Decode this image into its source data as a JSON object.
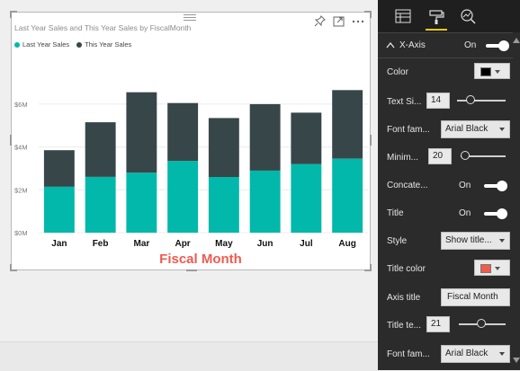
{
  "chart_data": {
    "type": "bar",
    "title": "Last Year Sales and This Year Sales by FiscalMonth",
    "categories": [
      "Jan",
      "Feb",
      "Mar",
      "Apr",
      "May",
      "Jun",
      "Jul",
      "Aug"
    ],
    "series": [
      {
        "name": "Last Year Sales",
        "color": "#01b8aa",
        "values": [
          2.15,
          2.6,
          2.8,
          3.35,
          2.6,
          2.9,
          3.2,
          3.45
        ]
      },
      {
        "name": "This Year Sales",
        "color": "#374649",
        "values": [
          1.7,
          2.55,
          3.75,
          2.7,
          2.75,
          3.1,
          2.4,
          3.2
        ]
      }
    ],
    "stacked": true,
    "y_ticks": [
      "$0M",
      "$2M",
      "$4M",
      "$6M"
    ],
    "ylim": [
      0,
      7
    ],
    "xlabel": "Fiscal Month",
    "xlabel_color": "#f05a4f",
    "grid": true,
    "legend_position": "top-left"
  },
  "legend": [
    {
      "label": "Last Year Sales",
      "color": "#01b8aa"
    },
    {
      "label": "This Year Sales",
      "color": "#374649"
    }
  ],
  "visual_icons": [
    "pin-icon",
    "focus-mode-icon",
    "more-options-icon"
  ],
  "panel": {
    "tabs": [
      "fields-icon",
      "format-paint-roller-icon",
      "analytics-icon"
    ],
    "active_tab": 1,
    "section": {
      "label": "X-Axis",
      "toggle": "On"
    },
    "color": {
      "label": "Color",
      "value": "#000000"
    },
    "text_size": {
      "label": "Text Si...",
      "value": "14",
      "level": 0.3
    },
    "font_family": {
      "label": "Font fam...",
      "value": "Arial Black"
    },
    "minimum": {
      "label": "Minim...",
      "value": "20",
      "level": 0.0
    },
    "concatenate": {
      "label": "Concate...",
      "toggle": "On"
    },
    "title": {
      "label": "Title",
      "toggle": "On"
    },
    "style": {
      "label": "Style",
      "value": "Show title..."
    },
    "title_color": {
      "label": "Title color",
      "value": "#f05a4f"
    },
    "axis_title": {
      "label": "Axis title",
      "value": "Fiscal Month"
    },
    "title_text_size": {
      "label": "Title te...",
      "value": "21",
      "level": 0.4
    },
    "font_family2": {
      "label": "Font fam...",
      "value": "Arial Black"
    }
  },
  "colors": {
    "accent": "#f2c811",
    "panel_bg": "#2b2b2b"
  }
}
